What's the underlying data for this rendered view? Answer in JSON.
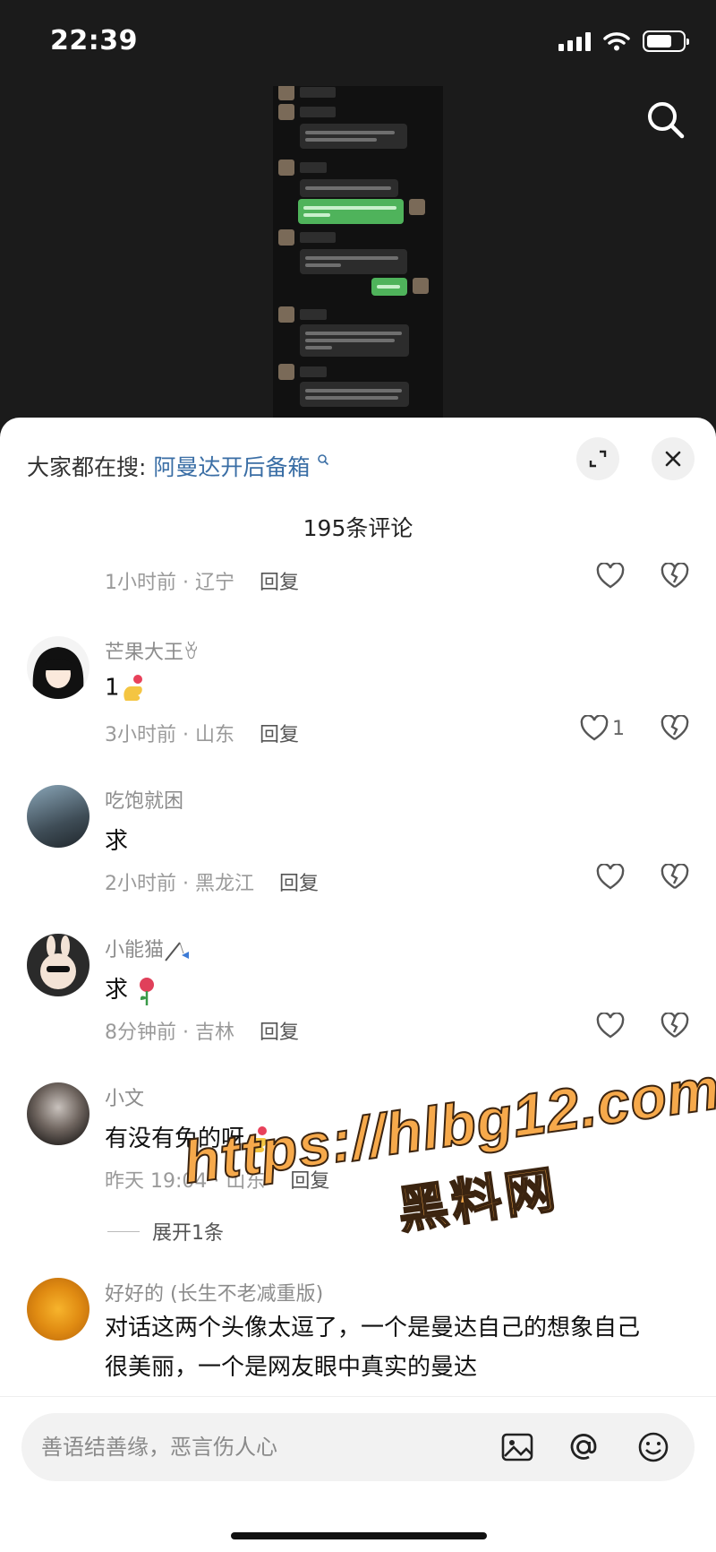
{
  "status_bar": {
    "time": "22:39"
  },
  "hot_search": {
    "prefix": "大家都在搜:",
    "term": "阿曼达开后备箱",
    "suffix_icon": "search-icon"
  },
  "comment_count": "195条评论",
  "comments": [
    {
      "name": "",
      "text": "",
      "time": "1小时前 · 辽宁",
      "reply": "回复",
      "likes": ""
    },
    {
      "name": "芒果大王ꈊ",
      "text": "1",
      "time": "3小时前 · 山东",
      "reply": "回复",
      "likes": "1"
    },
    {
      "name": "吃饱就困",
      "text": "求",
      "time": "2小时前 · 黑龙江",
      "reply": "回复",
      "likes": ""
    },
    {
      "name": "小能猫",
      "text": "求",
      "time": "8分钟前 · 吉林",
      "reply": "回复",
      "likes": ""
    },
    {
      "name": "小文",
      "text": "有没有免的呀",
      "time": "昨天 19:04 · 山东",
      "reply": "回复",
      "likes": ""
    },
    {
      "name": "好好的 (长生不老减重版)",
      "text_line1": "对话这两个头像太逗了，一个是曼达自己的想象自己",
      "text_line2": "很美丽，一个是网友眼中真实的曼达"
    }
  ],
  "expand_replies": "展开1条",
  "input": {
    "placeholder": "善语结善缘，恶言伤人心"
  },
  "watermark": {
    "url": "https://hlbg12.com",
    "site": "黑料网"
  },
  "colors": {
    "accent_link": "#3a6ea5",
    "watermark": "#f6a94b",
    "panel_bg": "#ffffff",
    "video_bg": "#1b1b1b"
  }
}
